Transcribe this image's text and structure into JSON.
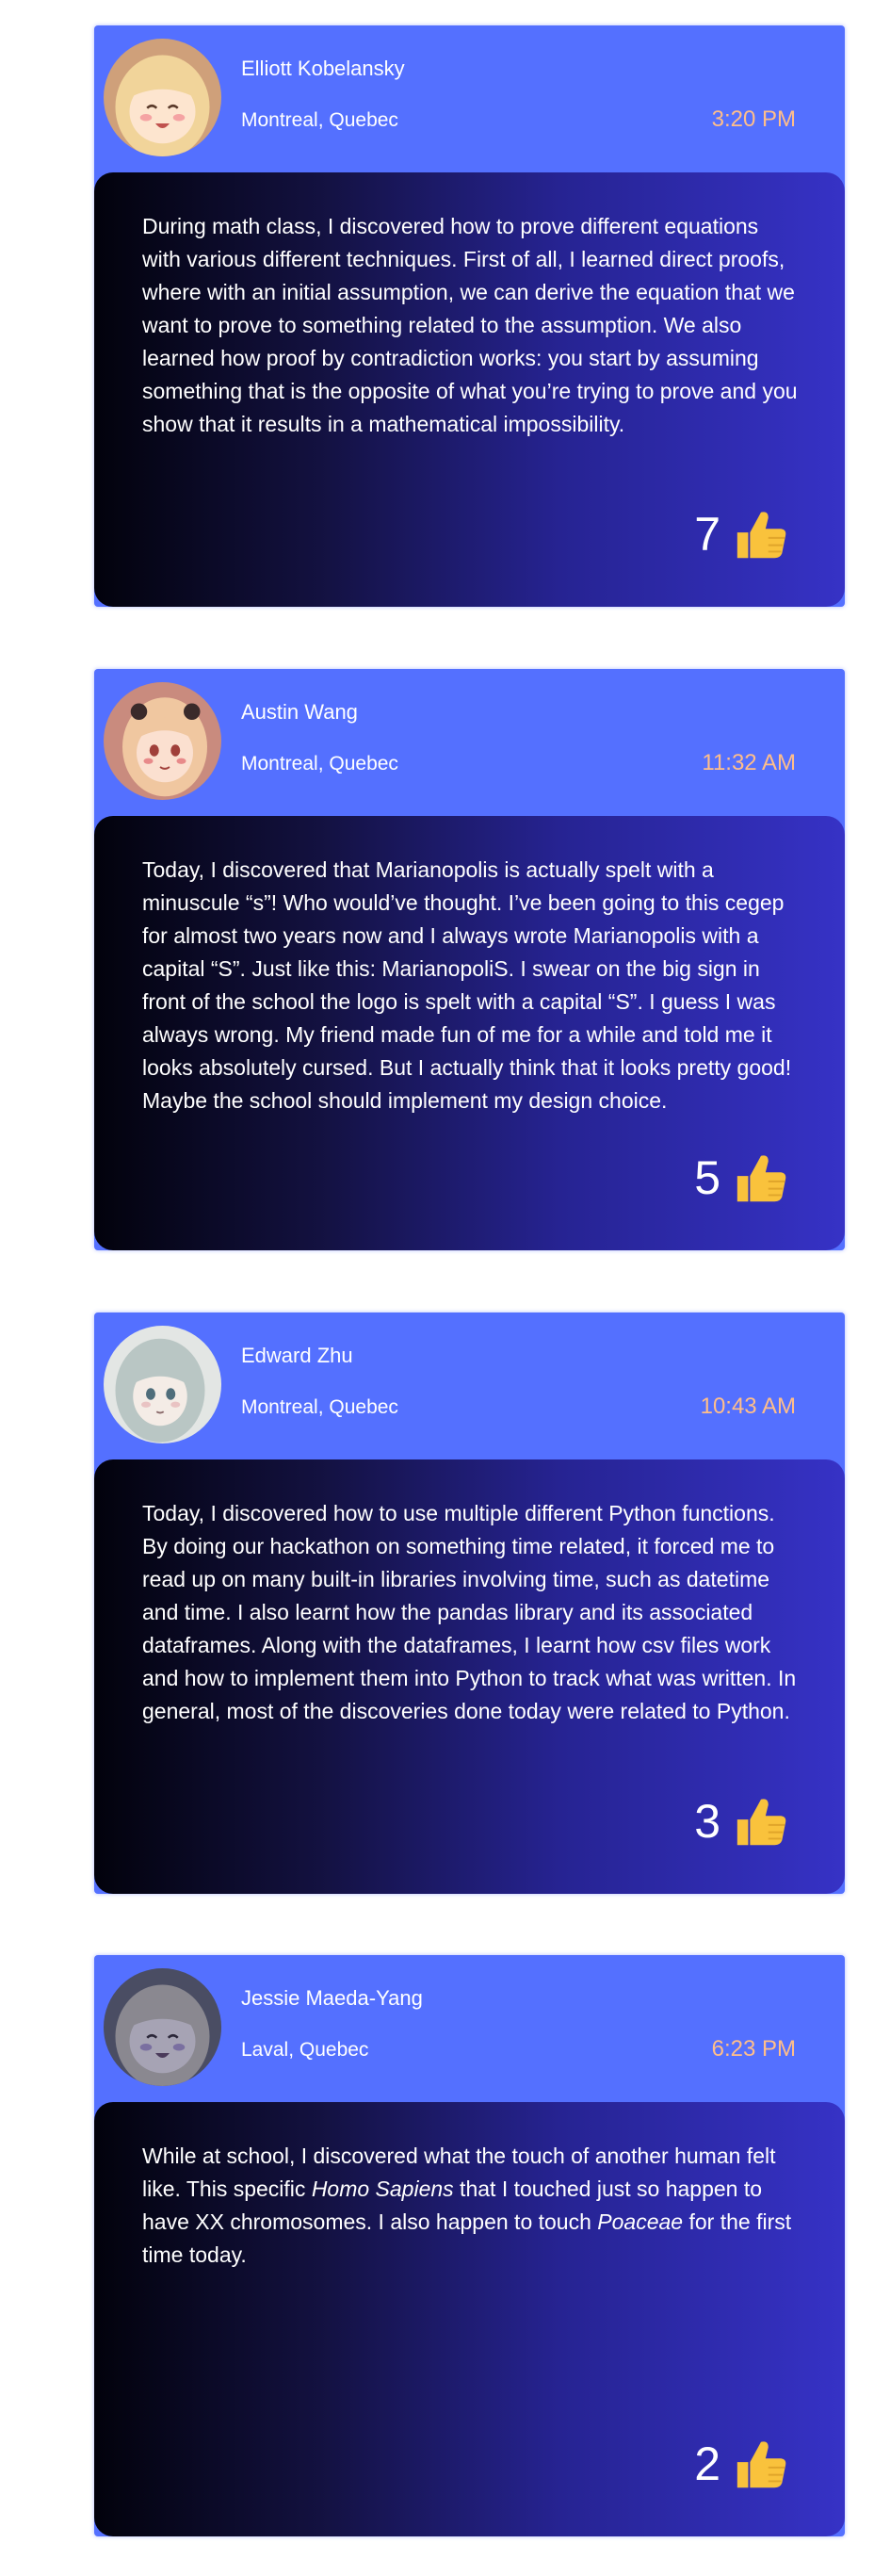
{
  "posts": [
    {
      "author": "Elliott Kobelansky",
      "location": "Montreal, Quebec",
      "time": "3:20 PM",
      "text": "During math class, I discovered how to prove different equations with various different techniques. First of all, I learned direct proofs, where with an initial assumption, we can derive the equation that we want to prove to something related to the assumption. We also learned how proof by contradiction works: you start by assuming something that is the opposite of what you’re trying to prove and you show that it results in a mathematical impossibility.",
      "likes": "7",
      "avatar_colors": {
        "bg": "#cfa07a",
        "hair": "#f1d49a",
        "skin": "#fde5cf",
        "blush": "#f5a3a3"
      }
    },
    {
      "author": "Austin Wang",
      "location": "Montreal, Quebec",
      "time": "11:32 AM",
      "text": "Today, I discovered that Marianopolis is actually spelt with a minuscule “s”! Who would’ve thought. I’ve been going to this cegep for almost two years now and I always wrote Marianopolis with a capital “S”. Just like this: MarianopoliS. I swear on the big sign in front of the school the logo is spelt with a capital “S”. I guess I was always wrong. My friend made fun of me for a while and told me it looks absolutely cursed. But I actually think that it looks pretty good! Maybe the school should implement my design choice.",
      "likes": "5",
      "avatar_colors": {
        "bg": "#c98b7e",
        "hair": "#f0c7a0",
        "skin": "#fbe0d0",
        "blush": "#e88a8a"
      }
    },
    {
      "author": "Edward Zhu",
      "location": "Montreal, Quebec",
      "time": "10:43 AM",
      "text": "Today, I discovered how to use multiple different Python functions. By doing our hackathon on something time related, it forced me to read up on many built-in libraries involving time, such as datetime and time. I also learnt how the pandas library and its associated dataframes. Along with the dataframes, I learnt how csv files work and how to implement them into Python to track what was written. In general, most of the discoveries done today were related to Python.",
      "likes": "3",
      "avatar_colors": {
        "bg": "#e3e6e4",
        "hair": "#b9c6c4",
        "skin": "#f4ece6",
        "blush": "#e9c3c3"
      }
    },
    {
      "author": "Jessie Maeda-Yang",
      "location": "Laval, Quebec",
      "time": "6:23 PM",
      "text_parts": [
        "While at school, I discovered what the touch of another human felt like. This specific ",
        "Homo Sapiens",
        " that I touched just so happen to have XX chromosomes. I also happen to touch ",
        "Poaceae",
        " for the first time today."
      ],
      "likes": "2",
      "avatar_colors": {
        "bg": "#4a4d63",
        "hair": "#8a8890",
        "skin": "#a6a3b4",
        "blush": "#7a6fa0"
      }
    }
  ],
  "colors": {
    "card": "#5470ff",
    "time": "#ffbe8a",
    "thumb": "#f9c23c"
  },
  "icons": {
    "like": "thumbs-up-icon"
  }
}
